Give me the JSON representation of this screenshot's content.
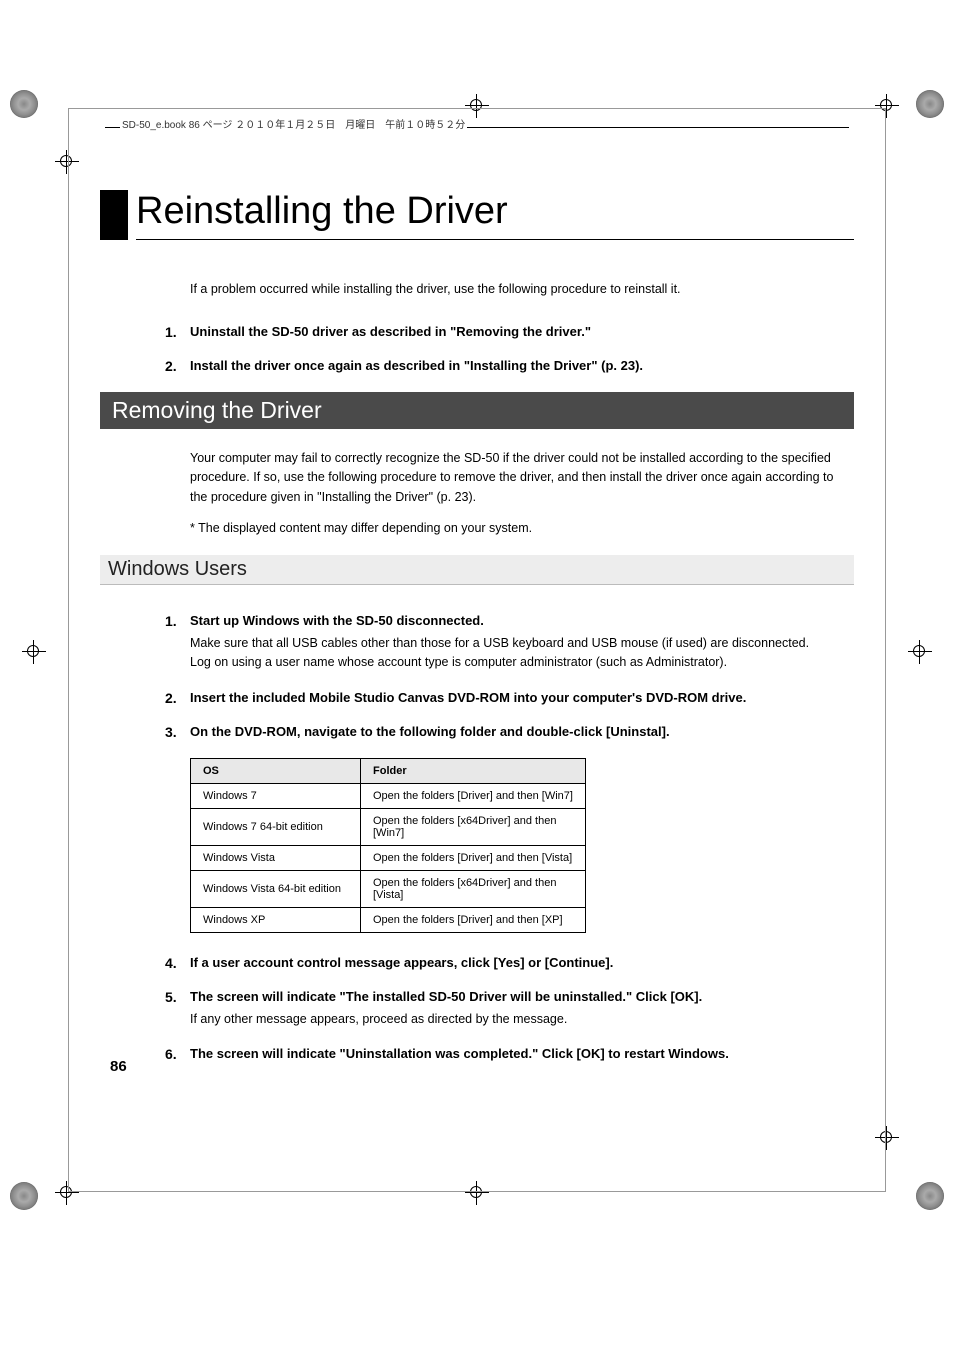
{
  "header": "SD-50_e.book  86 ページ  ２０１０年１月２５日　月曜日　午前１０時５２分",
  "title": "Reinstalling the Driver",
  "intro": "If a problem occurred while installing the driver, use the following procedure to reinstall it.",
  "top_steps": [
    {
      "n": "1.",
      "bold": "Uninstall the SD-50 driver as described in \"Removing the driver.\""
    },
    {
      "n": "2.",
      "bold": "Install the driver once again as described in  \"Installing the Driver\" (p. 23)."
    }
  ],
  "section1": "Removing the Driver",
  "section1_body": "Your computer may fail to correctly recognize the SD-50 if the driver could not be installed according to the specified procedure. If so, use the following procedure to remove the driver, and then install the driver once again according to the procedure given in  \"Installing the Driver\" (p. 23).",
  "section1_note": "*   The displayed content may differ depending on your system.",
  "subsection": "Windows Users",
  "win_steps": [
    {
      "n": "1.",
      "bold": "Start up Windows with the SD-50 disconnected.",
      "text": "Make sure that all USB cables other than those for a USB keyboard and USB mouse (if used) are disconnected.\nLog on using a user name whose account type is computer administrator (such as Administrator)."
    },
    {
      "n": "2.",
      "bold": "Insert the included Mobile Studio Canvas DVD-ROM into your computer's DVD-ROM drive."
    },
    {
      "n": "3.",
      "bold": "On the DVD-ROM, navigate to the following folder and double-click [Uninstal]."
    },
    {
      "n": "4.",
      "bold": "If a user account control message appears, click [Yes] or [Continue]."
    },
    {
      "n": "5.",
      "bold": "The screen will indicate \"The installed SD-50 Driver will be uninstalled.\" Click [OK].",
      "text": "If any other message appears, proceed as directed by the message."
    },
    {
      "n": "6.",
      "bold": "The screen will indicate \"Uninstallation was completed.\" Click [OK] to restart Windows."
    }
  ],
  "table": {
    "headers": [
      "OS",
      "Folder"
    ],
    "rows": [
      [
        "Windows 7",
        "Open the folders [Driver] and then [Win7]"
      ],
      [
        "Windows 7 64-bit edition",
        "Open the folders [x64Driver] and then [Win7]"
      ],
      [
        "Windows Vista",
        "Open the folders [Driver] and then [Vista]"
      ],
      [
        "Windows Vista 64-bit edition",
        "Open the folders [x64Driver] and then [Vista]"
      ],
      [
        "Windows XP",
        "Open the folders [Driver] and then [XP]"
      ]
    ]
  },
  "page_num": "86"
}
